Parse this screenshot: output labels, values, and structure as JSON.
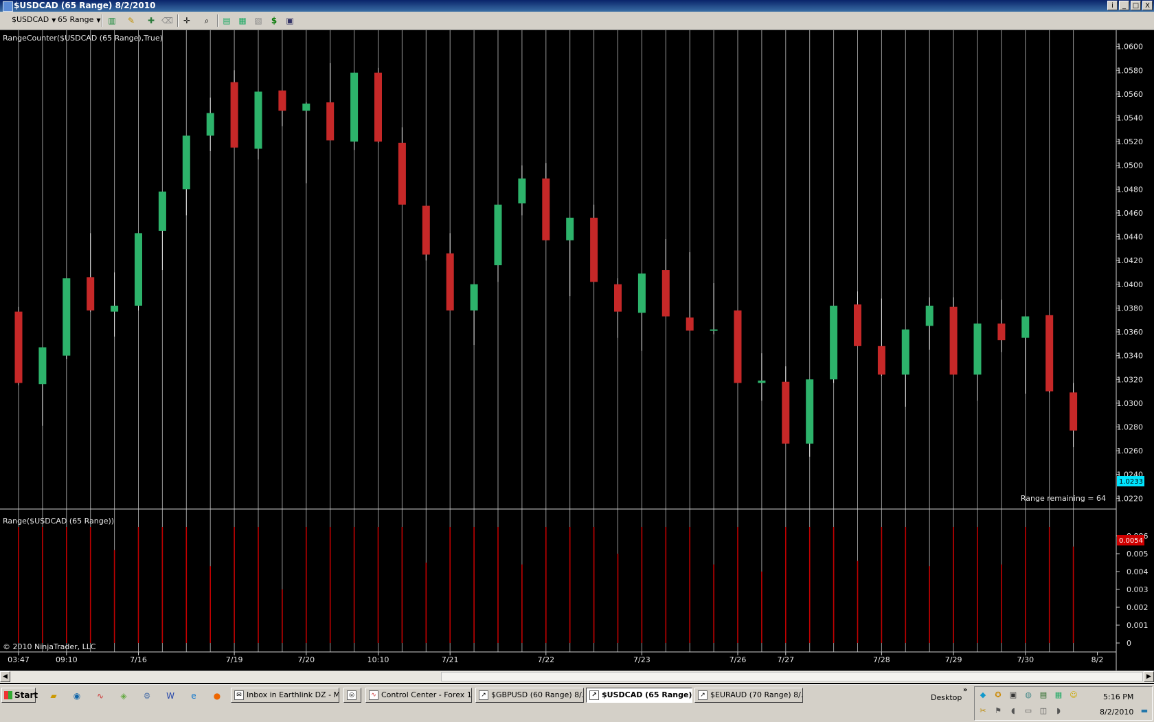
{
  "window": {
    "title": "$USDCAD (65 Range)  8/2/2010",
    "buttons": [
      "i",
      "_",
      "□",
      "X"
    ]
  },
  "toolbar": {
    "instrument": "$USDCAD",
    "period": "65 Range",
    "icons": [
      "bar-style-icon",
      "drawing-pencil-icon",
      "pin-icon",
      "eraser-icon",
      "crosshair-icon",
      "zoom-icon",
      "properties-icon",
      "indicators-icon",
      "strategies-icon",
      "order-dollar-icon",
      "data-box-icon"
    ]
  },
  "chart": {
    "price_label": "RangeCounter($USDCAD (65 Range),True)",
    "range_remaining": "Range remaining = 64",
    "lower_label": "Range($USDCAD (65 Range))",
    "copyright": "© 2010 NinjaTrader, LLC",
    "last_price": "1.0233",
    "last_range": "0.0054",
    "colors": {
      "up": "#2db36b",
      "down": "#c62828",
      "background": "#000000",
      "grid": "#b0b0b0",
      "last_price_tag": "#00e5ff",
      "last_range_tag": "#d00000"
    }
  },
  "chart_data": [
    {
      "type": "candlestick",
      "title": "RangeCounter($USDCAD (65 Range),True)",
      "ylim": [
        1.0215,
        1.0605
      ],
      "yticks": [
        "1.0220",
        "1.0240",
        "1.0260",
        "1.0280",
        "1.0300",
        "1.0320",
        "1.0340",
        "1.0360",
        "1.0380",
        "1.0400",
        "1.0420",
        "1.0440",
        "1.0460",
        "1.0480",
        "1.0500",
        "1.0520",
        "1.0540",
        "1.0560",
        "1.0580",
        "1.0600"
      ],
      "xticks": [
        {
          "bar": 0,
          "label": "03:47"
        },
        {
          "bar": 2,
          "label": "09:10"
        },
        {
          "bar": 5,
          "label": "7/16"
        },
        {
          "bar": 9,
          "label": "7/19"
        },
        {
          "bar": 12,
          "label": "7/20"
        },
        {
          "bar": 15,
          "label": "10:10"
        },
        {
          "bar": 18,
          "label": "7/21"
        },
        {
          "bar": 22,
          "label": "7/22"
        },
        {
          "bar": 26,
          "label": "7/23"
        },
        {
          "bar": 30,
          "label": "7/26"
        },
        {
          "bar": 32,
          "label": "7/27"
        },
        {
          "bar": 36,
          "label": "7/28"
        },
        {
          "bar": 39,
          "label": "7/29"
        },
        {
          "bar": 42,
          "label": "7/30"
        },
        {
          "bar": 45,
          "label": "8/2"
        }
      ],
      "ohlc": [
        [
          1.0377,
          1.0381,
          1.0315,
          1.0317
        ],
        [
          1.0316,
          1.0347,
          1.0281,
          1.0347
        ],
        [
          1.034,
          1.0405,
          1.0337,
          1.0405
        ],
        [
          1.0406,
          1.0443,
          1.0377,
          1.0378
        ],
        [
          1.0377,
          1.041,
          1.0356,
          1.0382
        ],
        [
          1.0382,
          1.0443,
          1.0378,
          1.0443
        ],
        [
          1.0445,
          1.0478,
          1.0412,
          1.0478
        ],
        [
          1.048,
          1.0525,
          1.0458,
          1.0525
        ],
        [
          1.0525,
          1.0557,
          1.0512,
          1.0544
        ],
        [
          1.057,
          1.058,
          1.0515,
          1.0515
        ],
        [
          1.0514,
          1.0562,
          1.0505,
          1.0562
        ],
        [
          1.0563,
          1.0563,
          1.0533,
          1.0546
        ],
        [
          1.0546,
          1.0553,
          1.0485,
          1.0552
        ],
        [
          1.0553,
          1.0586,
          1.0521,
          1.0521
        ],
        [
          1.052,
          1.0578,
          1.0513,
          1.0578
        ],
        [
          1.0578,
          1.0582,
          1.0519,
          1.052
        ],
        [
          1.0519,
          1.0532,
          1.0467,
          1.0467
        ],
        [
          1.0466,
          1.0466,
          1.042,
          1.0425
        ],
        [
          1.0426,
          1.0443,
          1.0378,
          1.0378
        ],
        [
          1.0378,
          1.04,
          1.0349,
          1.04
        ],
        [
          1.0416,
          1.0467,
          1.0402,
          1.0467
        ],
        [
          1.0468,
          1.05,
          1.0458,
          1.0489
        ],
        [
          1.0489,
          1.0502,
          1.0437,
          1.0437
        ],
        [
          1.0437,
          1.0456,
          1.039,
          1.0456
        ],
        [
          1.0456,
          1.0467,
          1.0402,
          1.0402
        ],
        [
          1.04,
          1.0405,
          1.0355,
          1.0377
        ],
        [
          1.0376,
          1.0409,
          1.0344,
          1.0409
        ],
        [
          1.0412,
          1.0438,
          1.0373,
          1.0373
        ],
        [
          1.0372,
          1.0427,
          1.0361,
          1.0361
        ],
        [
          1.0361,
          1.0401,
          1.0358,
          1.0362
        ],
        [
          1.0378,
          1.0378,
          1.0317,
          1.0317
        ],
        [
          1.0317,
          1.0342,
          1.0302,
          1.0319
        ],
        [
          1.0318,
          1.0331,
          1.0266,
          1.0266
        ],
        [
          1.0266,
          1.032,
          1.0255,
          1.032
        ],
        [
          1.032,
          1.0382,
          1.0317,
          1.0382
        ],
        [
          1.0383,
          1.0394,
          1.0348,
          1.0348
        ],
        [
          1.0348,
          1.0388,
          1.0323,
          1.0324
        ],
        [
          1.0324,
          1.0362,
          1.0297,
          1.0362
        ],
        [
          1.0365,
          1.0389,
          1.0345,
          1.0382
        ],
        [
          1.0381,
          1.0389,
          1.0324,
          1.0324
        ],
        [
          1.0324,
          1.0367,
          1.0302,
          1.0367
        ],
        [
          1.0367,
          1.0387,
          1.0343,
          1.0353
        ],
        [
          1.0355,
          1.0373,
          1.0308,
          1.0373
        ],
        [
          1.0374,
          1.0374,
          1.0309,
          1.031
        ],
        [
          1.0309,
          1.0317,
          1.0263,
          1.0277
        ]
      ]
    },
    {
      "type": "bar",
      "title": "Range($USDCAD (65 Range))",
      "ylim": [
        0,
        0.0065
      ],
      "yticks": [
        "0",
        "0.001",
        "0.002",
        "0.003",
        "0.004",
        "0.005",
        "0.006"
      ],
      "values": [
        0.0065,
        0.0065,
        0.0065,
        0.0065,
        0.0052,
        0.0065,
        0.0065,
        0.0065,
        0.0043,
        0.0065,
        0.0065,
        0.003,
        0.0065,
        0.0065,
        0.0065,
        0.0065,
        0.0065,
        0.0045,
        0.0065,
        0.0065,
        0.0065,
        0.0044,
        0.0065,
        0.0065,
        0.0065,
        0.005,
        0.0065,
        0.0065,
        0.0065,
        0.0044,
        0.0065,
        0.004,
        0.0065,
        0.0065,
        0.0065,
        0.0046,
        0.0065,
        0.0065,
        0.0043,
        0.0065,
        0.0065,
        0.0044,
        0.0065,
        0.0065,
        0.0054
      ]
    }
  ],
  "scrollbar": {
    "left_arrow": "◀",
    "right_arrow": "▶"
  },
  "taskbar": {
    "start": "Start",
    "quicklaunch": [
      "folder-icon",
      "browser-icon",
      "app-icon",
      "network-icon",
      "tools-icon",
      "word-icon",
      "ie-icon",
      "firefox-icon"
    ],
    "buttons": [
      {
        "label": "Inbox in Earthlink DZ - Mi...",
        "active": false
      },
      {
        "label": "",
        "active": false
      },
      {
        "label": "Control Center - Forex 1",
        "active": false
      },
      {
        "label": "$GBPUSD (60 Range)  8/...",
        "active": false
      },
      {
        "label": "$USDCAD (65 Range) ...",
        "active": true
      },
      {
        "label": "$EURAUD (70 Range)  8/...",
        "active": false
      }
    ],
    "desktop": "Desktop",
    "chevron": "»",
    "time": "5:16 PM",
    "date": "8/2/2010"
  }
}
